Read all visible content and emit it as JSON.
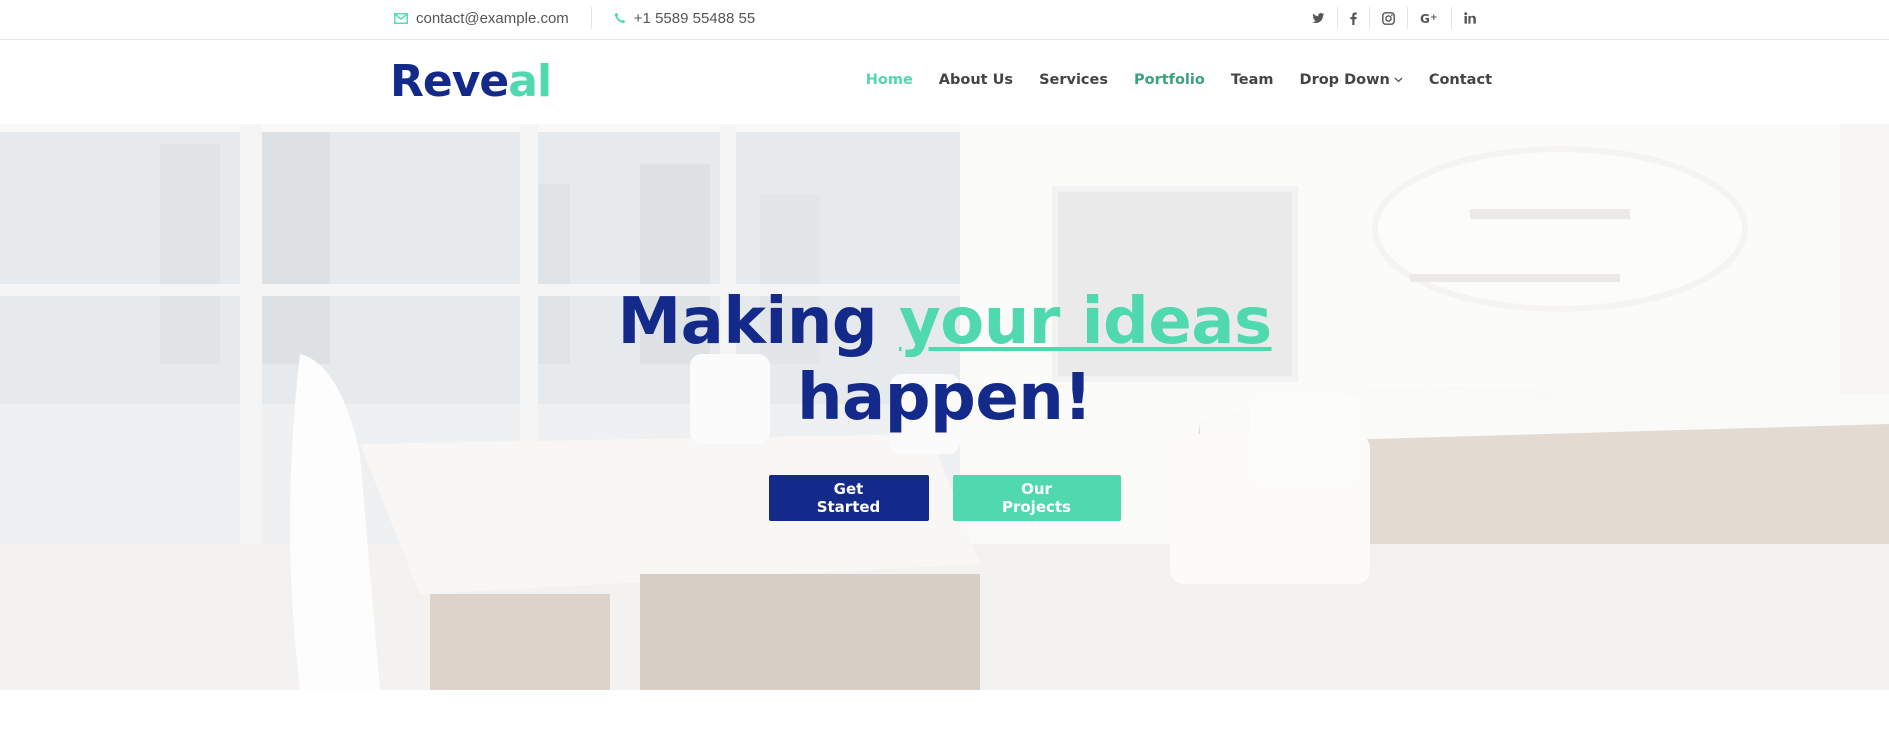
{
  "topbar": {
    "email": "contact@example.com",
    "phone": "+1 5589 55488 55",
    "email_icon": "envelope-icon",
    "phone_icon": "phone-icon",
    "social": [
      "twitter-icon",
      "facebook-icon",
      "instagram-icon",
      "google-plus-icon",
      "linkedin-icon"
    ]
  },
  "header": {
    "logo_part1": "Reve",
    "logo_part2": "al",
    "nav": {
      "home": "Home",
      "about": "About Us",
      "services": "Services",
      "portfolio": "Portfolio",
      "team": "Team",
      "dropdown": "Drop Down",
      "contact": "Contact"
    }
  },
  "hero": {
    "line1_a": "Making ",
    "line1_b": "your ideas",
    "line2": "happen!",
    "primary_button": "Get Started",
    "secondary_button": "Our Projects"
  },
  "colors": {
    "brand_navy": "#142a8a",
    "brand_green": "#50d8af",
    "text": "#444444"
  }
}
